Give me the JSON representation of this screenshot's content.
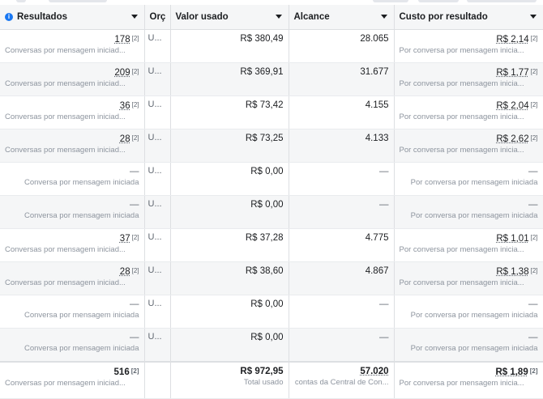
{
  "headers": {
    "resultados": "Resultados",
    "orcamento": "Orç",
    "valor_usado": "Valor usado",
    "alcance": "Alcance",
    "custo": "Custo por resultado"
  },
  "rows": [
    {
      "res": "178",
      "res_sub": "Conversas por mensagem iniciad...",
      "orc": "U...",
      "valor": "R$ 380,49",
      "alcance": "28.065",
      "custo": "R$ 2,14",
      "custo_sub": "Por conversa por mensagem inicia..."
    },
    {
      "res": "209",
      "res_sub": "Conversas por mensagem iniciad...",
      "orc": "U...",
      "valor": "R$ 369,91",
      "alcance": "31.677",
      "custo": "R$ 1,77",
      "custo_sub": "Por conversa por mensagem inicia..."
    },
    {
      "res": "36",
      "res_sub": "Conversas por mensagem iniciad...",
      "orc": "U...",
      "valor": "R$ 73,42",
      "alcance": "4.155",
      "custo": "R$ 2,04",
      "custo_sub": "Por conversa por mensagem inicia..."
    },
    {
      "res": "28",
      "res_sub": "Conversas por mensagem iniciad...",
      "orc": "U...",
      "valor": "R$ 73,25",
      "alcance": "4.133",
      "custo": "R$ 2,62",
      "custo_sub": "Por conversa por mensagem inicia..."
    },
    {
      "res": "—",
      "res_sub": "Conversa por mensagem iniciada",
      "orc": "U...",
      "valor": "R$ 0,00",
      "alcance": "—",
      "custo": "—",
      "custo_sub": "Por conversa por mensagem iniciada"
    },
    {
      "res": "—",
      "res_sub": "Conversa por mensagem iniciada",
      "orc": "U...",
      "valor": "R$ 0,00",
      "alcance": "—",
      "custo": "—",
      "custo_sub": "Por conversa por mensagem iniciada"
    },
    {
      "res": "37",
      "res_sub": "Conversas por mensagem iniciad...",
      "orc": "U...",
      "valor": "R$ 37,28",
      "alcance": "4.775",
      "custo": "R$ 1,01",
      "custo_sub": "Por conversa por mensagem inicia..."
    },
    {
      "res": "28",
      "res_sub": "Conversas por mensagem iniciad...",
      "orc": "U...",
      "valor": "R$ 38,60",
      "alcance": "4.867",
      "custo": "R$ 1,38",
      "custo_sub": "Por conversa por mensagem inicia..."
    },
    {
      "res": "—",
      "res_sub": "Conversa por mensagem iniciada",
      "orc": "U...",
      "valor": "R$ 0,00",
      "alcance": "—",
      "custo": "—",
      "custo_sub": "Por conversa por mensagem iniciada"
    },
    {
      "res": "—",
      "res_sub": "Conversa por mensagem iniciada",
      "orc": "U...",
      "valor": "R$ 0,00",
      "alcance": "—",
      "custo": "—",
      "custo_sub": "Por conversa por mensagem iniciada"
    }
  ],
  "totals": {
    "res": "516",
    "res_sub": "Conversas por mensagem iniciad...",
    "valor": "R$ 972,95",
    "valor_sub": "Total usado",
    "alcance": "57.020",
    "alcance_sub": "contas da Central de Con...",
    "custo": "R$ 1,89",
    "custo_sub": "Por conversa por mensagem inicia..."
  },
  "icons": {
    "info": "info-icon",
    "caret": "caret-down-icon",
    "breakdown": "breakdown-icon"
  },
  "colors": {
    "header_bg": "#f5f6f7",
    "accent": "#1877f2",
    "muted": "#8d949e"
  }
}
